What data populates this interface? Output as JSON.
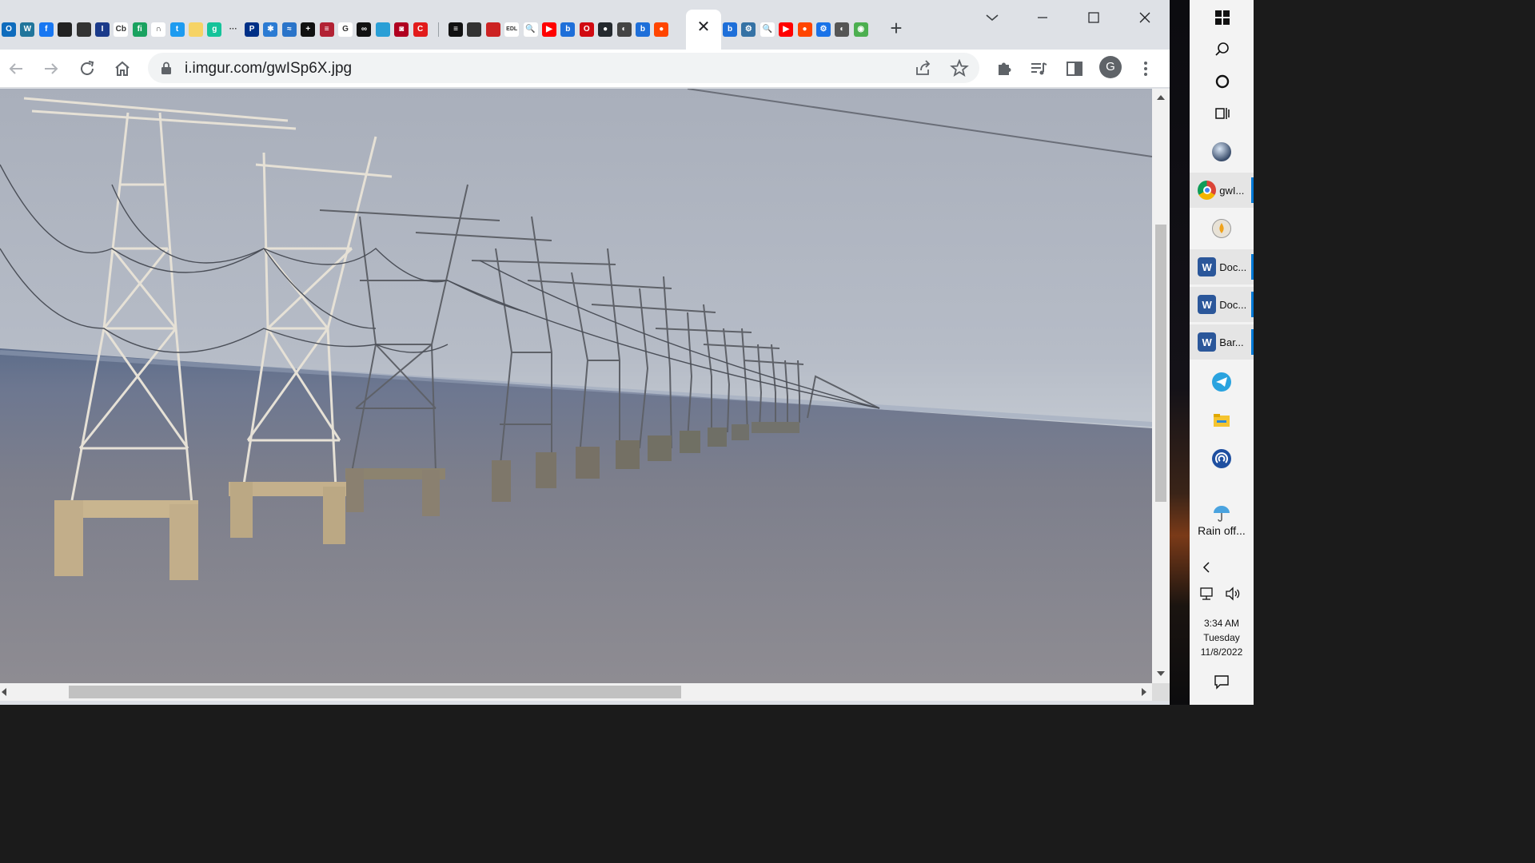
{
  "browser": {
    "address_bar": {
      "url": "i.imgur.com/gwISp6X.jpg"
    },
    "profile_initial": "G",
    "tab_close_glyph": "✕",
    "new_tab_glyph": "+",
    "colors": {
      "tabstrip": "#dee1e6",
      "toolbar": "#ffffff",
      "omnibox": "#f1f3f4"
    }
  },
  "tabs_left": [
    {
      "icon": "outlook-icon",
      "color": "#0f6cbd",
      "glyph": "O"
    },
    {
      "icon": "wordpress-icon",
      "color": "#21759b",
      "glyph": "W"
    },
    {
      "icon": "facebook-icon",
      "color": "#1877f2",
      "glyph": "f"
    },
    {
      "icon": "photo-icon",
      "color": "#222",
      "glyph": ""
    },
    {
      "icon": "photo-icon",
      "color": "#333",
      "glyph": ""
    },
    {
      "icon": "library-icon",
      "color": "#1a3a8a",
      "glyph": "I"
    },
    {
      "icon": "cb-icon",
      "color": "#ffffff",
      "glyph": "Cb"
    },
    {
      "icon": "fh-icon",
      "color": "#1aa260",
      "glyph": "fi"
    },
    {
      "icon": "tool-icon",
      "color": "#ffffff",
      "glyph": "∩"
    },
    {
      "icon": "twitter-icon",
      "color": "#1d9bf0",
      "glyph": "t"
    },
    {
      "icon": "bulb-icon",
      "color": "#f6d365",
      "glyph": ""
    },
    {
      "icon": "grammarly-icon",
      "color": "#15c39a",
      "glyph": "g"
    },
    {
      "icon": "dots-icon",
      "color": "#dee1e6",
      "glyph": "···"
    },
    {
      "icon": "paypal-icon",
      "color": "#003087",
      "glyph": "P"
    },
    {
      "icon": "compass-icon",
      "color": "#2b7bd3",
      "glyph": "✱"
    },
    {
      "icon": "app-icon",
      "color": "#2a74c9",
      "glyph": "≈"
    },
    {
      "icon": "plus-icon",
      "color": "#111111",
      "glyph": "+"
    },
    {
      "icon": "ssa-icon",
      "color": "#b22234",
      "glyph": "≡"
    },
    {
      "icon": "google-icon",
      "color": "#ffffff",
      "glyph": "G"
    },
    {
      "icon": "mask-icon",
      "color": "#111111",
      "glyph": "∞"
    },
    {
      "icon": "book-icon",
      "color": "#2a9fd6",
      "glyph": ""
    },
    {
      "icon": "camera-icon",
      "color": "#b00020",
      "glyph": "◙"
    },
    {
      "icon": "c-icon",
      "color": "#e21b1b",
      "glyph": "C"
    }
  ],
  "tabs_right_of_sep": [
    {
      "icon": "news-icon",
      "color": "#111111",
      "glyph": "≡"
    },
    {
      "icon": "photo-icon",
      "color": "#333333",
      "glyph": ""
    },
    {
      "icon": "flag-icon",
      "color": "#cc2222",
      "glyph": ""
    },
    {
      "icon": "edl-icon",
      "color": "#ffffff",
      "glyph": "EDL"
    },
    {
      "icon": "search-icon",
      "color": "#ffffff",
      "glyph": "🔍"
    },
    {
      "icon": "youtube-icon",
      "color": "#ff0000",
      "glyph": "▶"
    },
    {
      "icon": "bing-icon",
      "color": "#1e6fd9",
      "glyph": "b"
    },
    {
      "icon": "opera-icon",
      "color": "#d10a11",
      "glyph": "O"
    },
    {
      "icon": "github-icon",
      "color": "#24292e",
      "glyph": "●"
    },
    {
      "icon": "globe-icon",
      "color": "#444444",
      "glyph": "◐"
    },
    {
      "icon": "bing-icon",
      "color": "#1e6fd9",
      "glyph": "b"
    },
    {
      "icon": "reddit-icon",
      "color": "#ff4500",
      "glyph": "●"
    }
  ],
  "tabs_after_active": [
    {
      "icon": "bing-icon",
      "color": "#1e6fd9",
      "glyph": "b"
    },
    {
      "icon": "python-icon",
      "color": "#3572a5",
      "glyph": "⚙"
    },
    {
      "icon": "search-icon",
      "color": "#ffffff",
      "glyph": "🔍"
    },
    {
      "icon": "youtube-icon",
      "color": "#ff0000",
      "glyph": "▶"
    },
    {
      "icon": "reddit-icon",
      "color": "#ff4500",
      "glyph": "●"
    },
    {
      "icon": "settings-icon",
      "color": "#1a73e8",
      "glyph": "⚙"
    },
    {
      "icon": "globe-icon",
      "color": "#555555",
      "glyph": "◐"
    },
    {
      "icon": "chrome-icon",
      "color": "#4caf50",
      "glyph": "◉"
    }
  ],
  "taskbar": {
    "items": [
      {
        "name": "start-button",
        "icon": "windows-icon",
        "label": ""
      },
      {
        "name": "search-button",
        "icon": "search-icon",
        "label": ""
      },
      {
        "name": "cortana-button",
        "icon": "cortana-icon",
        "label": ""
      },
      {
        "name": "task-view-button",
        "icon": "task-view-icon",
        "label": ""
      },
      {
        "name": "taskbar-app-globe",
        "icon": "globe-icon",
        "label": ""
      },
      {
        "name": "taskbar-app-chrome",
        "icon": "chrome-icon",
        "label": "gwI..."
      },
      {
        "name": "taskbar-app-candle",
        "icon": "candle-icon",
        "label": ""
      },
      {
        "name": "taskbar-app-word-1",
        "icon": "word-icon",
        "label": "Doc..."
      },
      {
        "name": "taskbar-app-word-2",
        "icon": "word-icon",
        "label": "Doc..."
      },
      {
        "name": "taskbar-app-word-3",
        "icon": "word-icon",
        "label": "Bar..."
      },
      {
        "name": "taskbar-app-telegram",
        "icon": "telegram-icon",
        "label": ""
      },
      {
        "name": "taskbar-app-explorer",
        "icon": "folder-icon",
        "label": ""
      },
      {
        "name": "taskbar-app-podcast",
        "icon": "podcast-icon",
        "label": ""
      }
    ],
    "weather": "Rain off...",
    "clock": {
      "time": "3:34 AM",
      "day": "Tuesday",
      "date": "11/8/2022"
    },
    "accent": "#0078d4"
  }
}
